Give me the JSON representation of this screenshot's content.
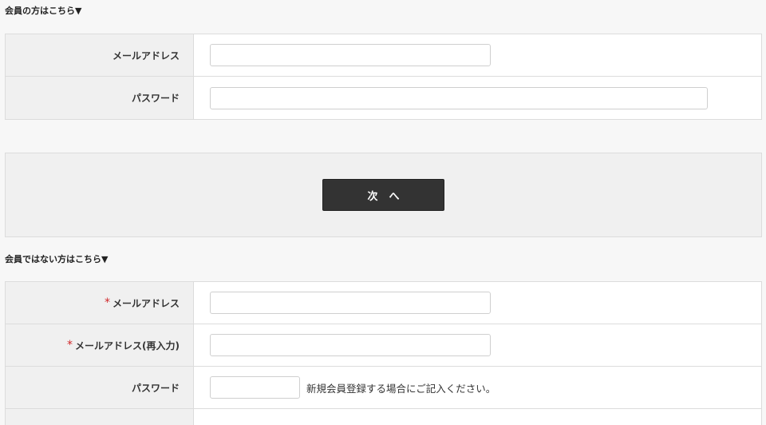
{
  "member_section": {
    "title": "会員の方はこちら▼",
    "email_label": "メールアドレス",
    "email_value": "",
    "password_label": "パスワード",
    "password_value": ""
  },
  "next_button": {
    "label": "次へ"
  },
  "guest_section": {
    "title": "会員ではない方はこちら▼",
    "required_mark": "*",
    "email_label": "メールアドレス",
    "email_confirm_label": "メールアドレス(再入力)",
    "password_label": "パスワード",
    "password_note": "新規会員登録する場合にご記入ください。"
  },
  "colors": {
    "background": "#f7f7f7",
    "label_bg": "#f0f0f0",
    "border": "#dcdcdc",
    "button_bg": "#333333",
    "required": "#d0282a"
  }
}
